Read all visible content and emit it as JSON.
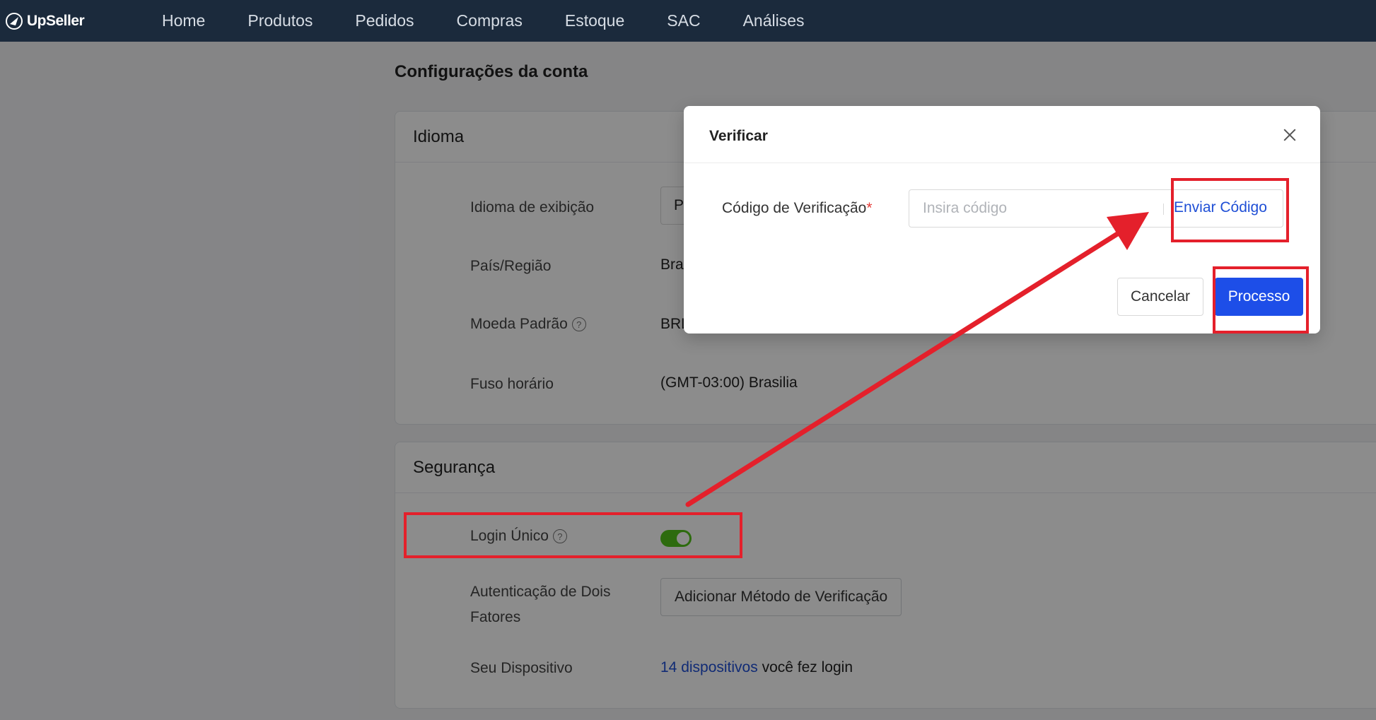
{
  "brand": {
    "name": "UpSeller",
    "icon": "upseller-logo-icon"
  },
  "nav": {
    "items": [
      {
        "label": "Home"
      },
      {
        "label": "Produtos"
      },
      {
        "label": "Pedidos"
      },
      {
        "label": "Compras"
      },
      {
        "label": "Estoque"
      },
      {
        "label": "SAC"
      },
      {
        "label": "Análises"
      }
    ]
  },
  "page": {
    "title": "Configurações da conta"
  },
  "language_section": {
    "title": "Idioma",
    "display_language": {
      "label": "Idioma de exibição",
      "value": "P"
    },
    "country": {
      "label": "País/Região",
      "value": "Bra"
    },
    "currency": {
      "label": "Moeda Padrão",
      "value": "BRL"
    },
    "timezone": {
      "label": "Fuso horário",
      "value": "(GMT-03:00) Brasilia"
    }
  },
  "security_section": {
    "title": "Segurança",
    "single_login": {
      "label": "Login Único",
      "enabled": true
    },
    "two_factor": {
      "label_line1": "Autenticação de Dois",
      "label_line2": "Fatores",
      "button": "Adicionar Método de Verificação"
    },
    "devices": {
      "label": "Seu Dispositivo",
      "link": "14 dispositivos",
      "suffix": " você fez login"
    }
  },
  "modal": {
    "title": "Verificar",
    "field_label": "Código de Verificação",
    "required_mark": "*",
    "input_placeholder": "Insira código",
    "input_value": "",
    "send_code": "Enviar Código",
    "cancel": "Cancelar",
    "submit": "Processo"
  },
  "colors": {
    "topbar": "#1b2a3c",
    "primary": "#1d4ee8",
    "link": "#1f4fd6",
    "toggle_on": "#52c41a",
    "annotation": "#e4202b"
  }
}
